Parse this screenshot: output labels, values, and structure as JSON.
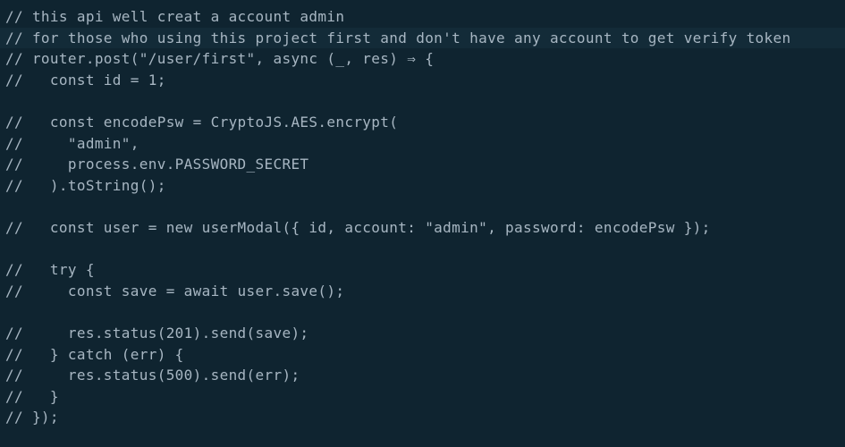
{
  "editor": {
    "colors": {
      "background": "#0f2430",
      "active_line": "#132b38",
      "comment_text": "#a7b6c2"
    },
    "lines": [
      {
        "text": "// this api well creat a account admin",
        "active": false
      },
      {
        "text": "// for those who using this project first and don't have any account to get verify token",
        "active": true
      },
      {
        "text": "// router.post(\"/user/first\", async (_, res) ⇒ {",
        "active": false
      },
      {
        "text": "//   const id = 1;",
        "active": false
      },
      {
        "text": "",
        "active": false
      },
      {
        "text": "//   const encodePsw = CryptoJS.AES.encrypt(",
        "active": false
      },
      {
        "text": "//     \"admin\",",
        "active": false
      },
      {
        "text": "//     process.env.PASSWORD_SECRET",
        "active": false
      },
      {
        "text": "//   ).toString();",
        "active": false
      },
      {
        "text": "",
        "active": false
      },
      {
        "text": "//   const user = new userModal({ id, account: \"admin\", password: encodePsw });",
        "active": false
      },
      {
        "text": "",
        "active": false
      },
      {
        "text": "//   try {",
        "active": false
      },
      {
        "text": "//     const save = await user.save();",
        "active": false
      },
      {
        "text": "",
        "active": false
      },
      {
        "text": "//     res.status(201).send(save);",
        "active": false
      },
      {
        "text": "//   } catch (err) {",
        "active": false
      },
      {
        "text": "//     res.status(500).send(err);",
        "active": false
      },
      {
        "text": "//   }",
        "active": false
      },
      {
        "text": "// });",
        "active": false
      }
    ]
  }
}
